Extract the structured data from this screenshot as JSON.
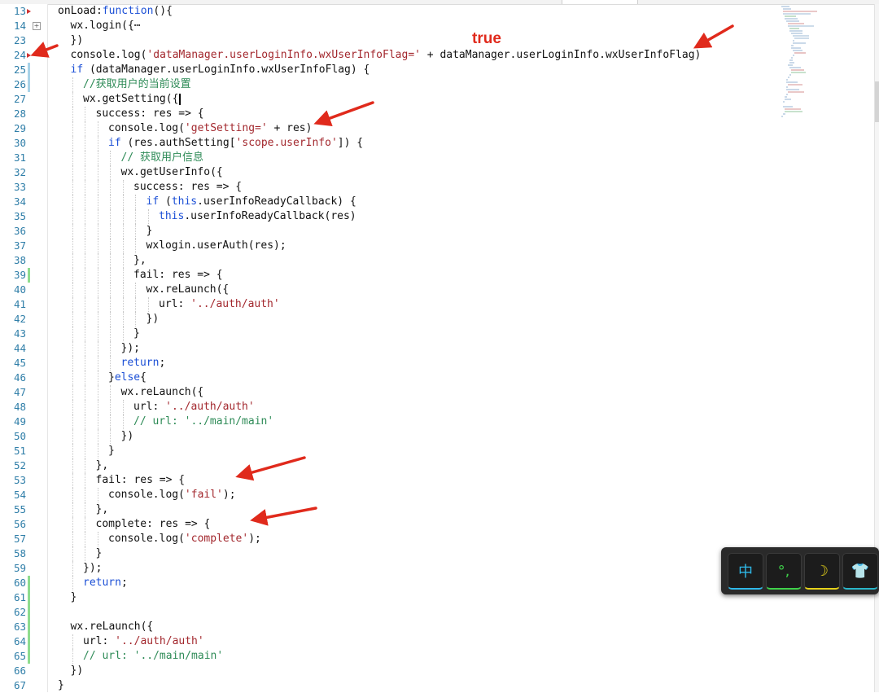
{
  "annotation": {
    "label": "true"
  },
  "editor": {
    "lines": [
      {
        "n": "13",
        "indent": 0,
        "segs": [
          [
            "",
            "onLoad:"
          ],
          [
            "kw",
            "function"
          ],
          [
            "",
            "(){"
          ]
        ]
      },
      {
        "n": "14",
        "indent": 1,
        "segs": [
          [
            "",
            "wx.login({"
          ],
          [
            "",
            "⋯"
          ]
        ]
      },
      {
        "n": "23",
        "indent": 1,
        "segs": [
          [
            "",
            "})"
          ]
        ]
      },
      {
        "n": "24",
        "indent": 1,
        "segs": [
          [
            "",
            "console.log("
          ],
          [
            "str",
            "'dataManager.userLoginInfo.wxUserInfoFlag='"
          ],
          [
            "",
            " + dataManager.userLoginInfo.wxUserInfoFlag)"
          ]
        ]
      },
      {
        "n": "25",
        "indent": 1,
        "segs": [
          [
            "kw",
            "if"
          ],
          [
            "",
            " (dataManager.userLoginInfo.wxUserInfoFlag) {"
          ]
        ]
      },
      {
        "n": "26",
        "indent": 2,
        "segs": [
          [
            "cm",
            "//获取用户的当前设置"
          ]
        ]
      },
      {
        "n": "27",
        "indent": 2,
        "segs": [
          [
            "",
            "wx.getSetting({"
          ]
        ]
      },
      {
        "n": "28",
        "indent": 3,
        "segs": [
          [
            "",
            "success: res => {"
          ]
        ]
      },
      {
        "n": "29",
        "indent": 4,
        "segs": [
          [
            "",
            "console.log("
          ],
          [
            "str",
            "'getSetting='"
          ],
          [
            "",
            " + res)"
          ]
        ]
      },
      {
        "n": "30",
        "indent": 4,
        "segs": [
          [
            "kw",
            "if"
          ],
          [
            "",
            " (res.authSetting["
          ],
          [
            "str",
            "'scope.userInfo'"
          ],
          [
            "",
            "]) {"
          ]
        ]
      },
      {
        "n": "31",
        "indent": 5,
        "segs": [
          [
            "cm",
            "// 获取用户信息"
          ]
        ]
      },
      {
        "n": "32",
        "indent": 5,
        "segs": [
          [
            "",
            "wx.getUserInfo({"
          ]
        ]
      },
      {
        "n": "33",
        "indent": 6,
        "segs": [
          [
            "",
            "success: res => {"
          ]
        ]
      },
      {
        "n": "34",
        "indent": 7,
        "segs": [
          [
            "kw",
            "if"
          ],
          [
            "",
            " ("
          ],
          [
            "kw",
            "this"
          ],
          [
            "",
            ".userInfoReadyCallback) {"
          ]
        ]
      },
      {
        "n": "35",
        "indent": 8,
        "segs": [
          [
            "kw",
            "this"
          ],
          [
            "",
            ".userInfoReadyCallback(res)"
          ]
        ]
      },
      {
        "n": "36",
        "indent": 7,
        "segs": [
          [
            "",
            "}"
          ]
        ]
      },
      {
        "n": "37",
        "indent": 7,
        "segs": [
          [
            "",
            "wxlogin.userAuth(res);"
          ]
        ]
      },
      {
        "n": "38",
        "indent": 6,
        "segs": [
          [
            "",
            "},"
          ]
        ]
      },
      {
        "n": "39",
        "indent": 6,
        "segs": [
          [
            "",
            "fail: res => {"
          ]
        ]
      },
      {
        "n": "40",
        "indent": 7,
        "segs": [
          [
            "",
            "wx.reLaunch({"
          ]
        ]
      },
      {
        "n": "41",
        "indent": 8,
        "segs": [
          [
            "",
            "url: "
          ],
          [
            "str",
            "'../auth/auth'"
          ]
        ]
      },
      {
        "n": "42",
        "indent": 7,
        "segs": [
          [
            "",
            "})"
          ]
        ]
      },
      {
        "n": "43",
        "indent": 6,
        "segs": [
          [
            "",
            "}"
          ]
        ]
      },
      {
        "n": "44",
        "indent": 5,
        "segs": [
          [
            "",
            "});"
          ]
        ]
      },
      {
        "n": "45",
        "indent": 5,
        "segs": [
          [
            "kw",
            "return"
          ],
          [
            "",
            ";"
          ]
        ]
      },
      {
        "n": "46",
        "indent": 4,
        "segs": [
          [
            "",
            "}"
          ],
          [
            "kw",
            "else"
          ],
          [
            "",
            "{"
          ]
        ]
      },
      {
        "n": "47",
        "indent": 5,
        "segs": [
          [
            "",
            "wx.reLaunch({"
          ]
        ]
      },
      {
        "n": "48",
        "indent": 6,
        "segs": [
          [
            "",
            "url: "
          ],
          [
            "str",
            "'../auth/auth'"
          ]
        ]
      },
      {
        "n": "49",
        "indent": 6,
        "segs": [
          [
            "cm",
            "// url: '../main/main'"
          ]
        ]
      },
      {
        "n": "50",
        "indent": 5,
        "segs": [
          [
            "",
            "})"
          ]
        ]
      },
      {
        "n": "51",
        "indent": 4,
        "segs": [
          [
            "",
            "}"
          ]
        ]
      },
      {
        "n": "52",
        "indent": 3,
        "segs": [
          [
            "",
            "},"
          ]
        ]
      },
      {
        "n": "53",
        "indent": 3,
        "segs": [
          [
            "",
            "fail: res => {"
          ]
        ]
      },
      {
        "n": "54",
        "indent": 4,
        "segs": [
          [
            "",
            "console.log("
          ],
          [
            "str",
            "'fail'"
          ],
          [
            "",
            ");"
          ]
        ]
      },
      {
        "n": "55",
        "indent": 3,
        "segs": [
          [
            "",
            "},"
          ]
        ]
      },
      {
        "n": "56",
        "indent": 3,
        "segs": [
          [
            "",
            "complete: res => {"
          ]
        ]
      },
      {
        "n": "57",
        "indent": 4,
        "segs": [
          [
            "",
            "console.log("
          ],
          [
            "str",
            "'complete'"
          ],
          [
            "",
            ");"
          ]
        ]
      },
      {
        "n": "58",
        "indent": 3,
        "segs": [
          [
            "",
            "}"
          ]
        ]
      },
      {
        "n": "59",
        "indent": 2,
        "segs": [
          [
            "",
            "});"
          ]
        ]
      },
      {
        "n": "60",
        "indent": 2,
        "segs": [
          [
            "kw",
            "return"
          ],
          [
            "",
            ";"
          ]
        ]
      },
      {
        "n": "61",
        "indent": 1,
        "segs": [
          [
            "",
            "}"
          ]
        ]
      },
      {
        "n": "62",
        "indent": 0,
        "segs": []
      },
      {
        "n": "63",
        "indent": 1,
        "segs": [
          [
            "",
            "wx.reLaunch({"
          ]
        ]
      },
      {
        "n": "64",
        "indent": 2,
        "segs": [
          [
            "",
            "url: "
          ],
          [
            "str",
            "'../auth/auth'"
          ]
        ]
      },
      {
        "n": "65",
        "indent": 2,
        "segs": [
          [
            "cm",
            "// url: '../main/main'"
          ]
        ]
      },
      {
        "n": "66",
        "indent": 1,
        "segs": [
          [
            "",
            "})"
          ]
        ]
      },
      {
        "n": "67",
        "indent": 0,
        "segs": [
          [
            "",
            "}"
          ]
        ]
      }
    ]
  },
  "ime_toolbar": {
    "buttons": [
      {
        "label": "中",
        "name": "ime-chinese-mode-button",
        "color": "#2fb8e8"
      },
      {
        "label": "°,",
        "name": "ime-punctuation-button",
        "color": "#3fd14a"
      },
      {
        "label": "☽",
        "name": "ime-moon-icon",
        "color": "#e6d21a"
      },
      {
        "label": "👕",
        "name": "ime-skin-icon",
        "color": "#29b6c9"
      }
    ]
  },
  "colors": {
    "accent_red": "#e02a1c",
    "keyword": "#1b4fd6",
    "string": "#a3282e",
    "comment": "#2e8b57",
    "line_number": "#2f7ea8"
  }
}
